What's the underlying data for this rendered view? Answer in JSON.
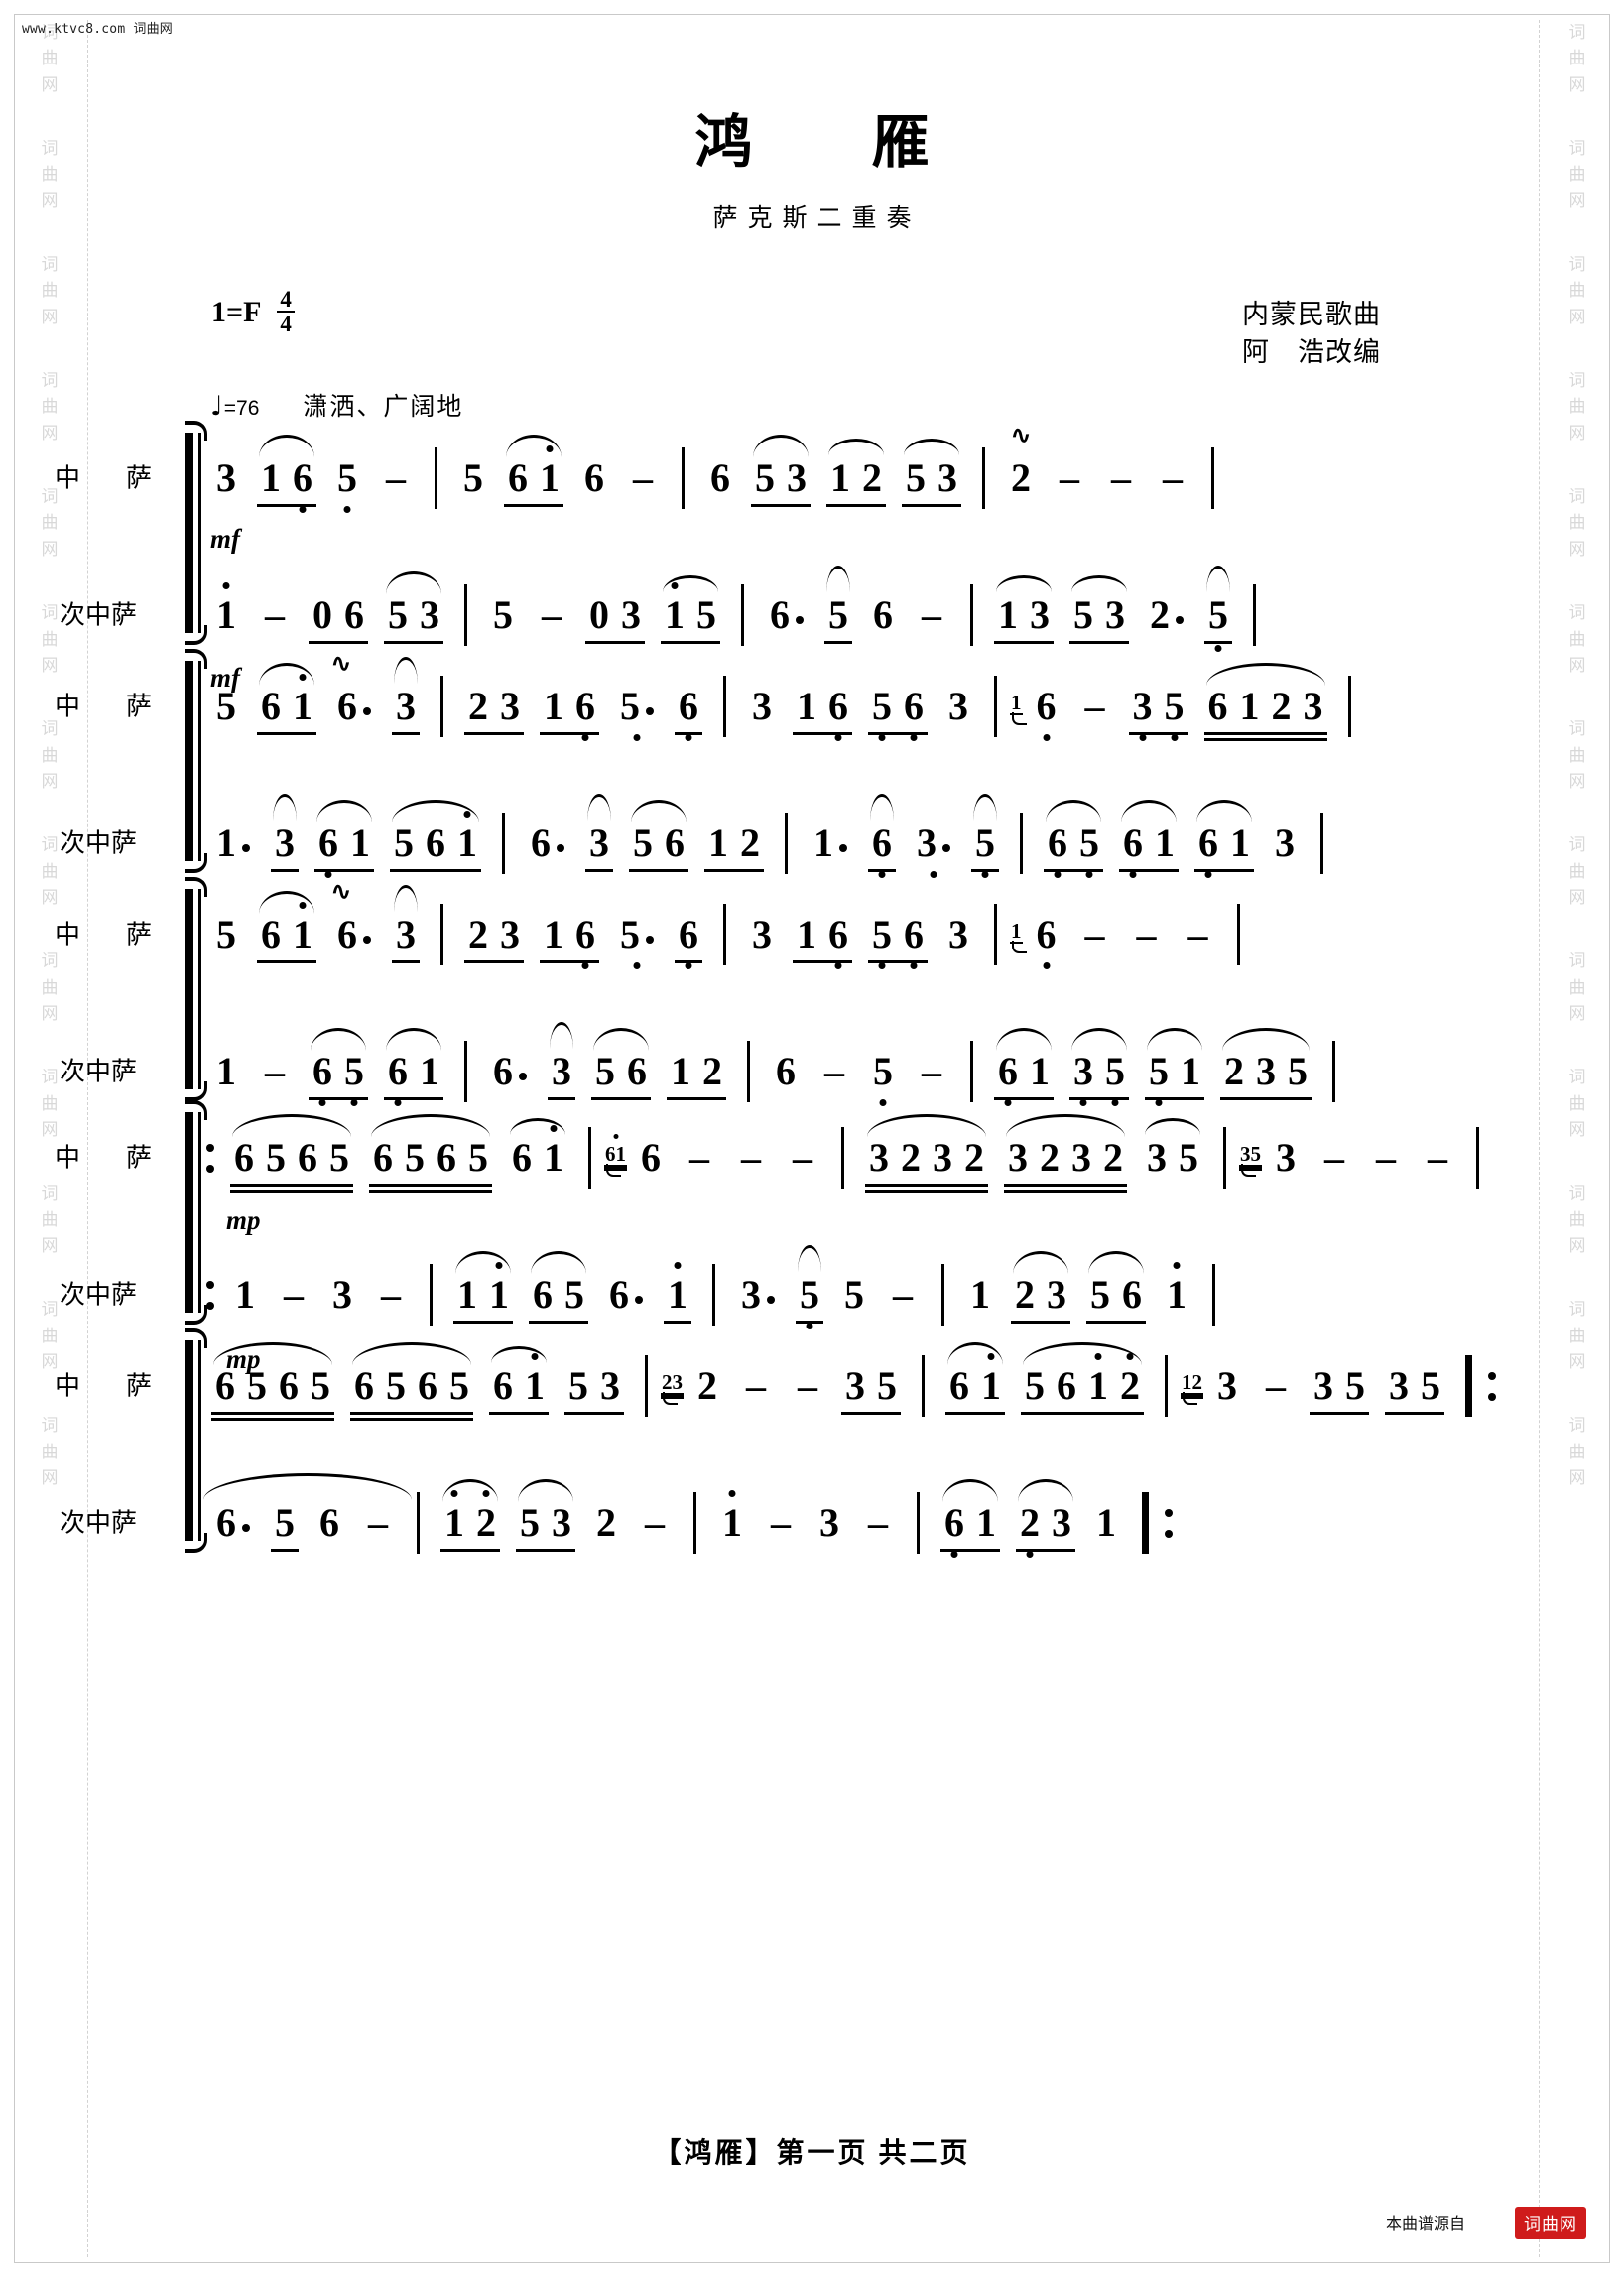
{
  "header": {
    "site_url": "www.ktvc8.com 词曲网",
    "title": "鸿雁",
    "subtitle": "萨克斯二重奏",
    "key_label": "1=F",
    "time_num": "4",
    "time_den": "4",
    "tempo_mark": "♩",
    "tempo_value": "=76",
    "expression": "潇洒、广阔地",
    "composer_line1": "内蒙民歌曲",
    "composer_line2": "阿　浩改编"
  },
  "watermark": {
    "text": "词曲网"
  },
  "parts": {
    "alto": "中　萨",
    "tenor": "次中萨"
  },
  "dynamics": {
    "mf": "mf",
    "mp": "mp"
  },
  "footer": {
    "page_note": "【鸿雁】第一页  共二页",
    "source_note": "本曲谱源自",
    "logo": "词曲网"
  },
  "chart_data": {
    "type": "table",
    "title": "鸿雁 — 萨克斯二重奏 (jianpu notation)",
    "key": "1=F",
    "meter": "4/4",
    "tempo_bpm": 76,
    "systems": [
      {
        "index": 1,
        "alto": [
          {
            "measure": 1,
            "notes": [
              "3",
              "1 6",
              "5̣",
              "-"
            ]
          },
          {
            "measure": 2,
            "notes": [
              "5",
              "6 1̇",
              "6",
              "-"
            ]
          },
          {
            "measure": 3,
            "notes": [
              "6",
              "5 3",
              "1 2",
              "5 3"
            ]
          },
          {
            "measure": 4,
            "notes": [
              "2 (trill)",
              "-",
              "-",
              "-"
            ]
          }
        ],
        "tenor": [
          {
            "measure": 1,
            "notes": [
              "1̇",
              "-",
              "0 6",
              "5 3"
            ]
          },
          {
            "measure": 2,
            "notes": [
              "5",
              "-",
              "0 3",
              "1̇ 5"
            ]
          },
          {
            "measure": 3,
            "notes": [
              "6.",
              "5",
              "6",
              "-"
            ]
          },
          {
            "measure": 4,
            "notes": [
              "1 3",
              "5 3",
              "2.",
              "5̣"
            ]
          }
        ]
      },
      {
        "index": 2,
        "alto": [
          {
            "measure": 5,
            "notes": [
              "5",
              "6 1̇",
              "6.",
              "3"
            ]
          },
          {
            "measure": 6,
            "notes": [
              "2 3",
              "1 6̣",
              "5̣.",
              "6̣"
            ]
          },
          {
            "measure": 7,
            "notes": [
              "3",
              "1 6̣",
              "5̣ 6̣",
              "3"
            ]
          },
          {
            "measure": 8,
            "notes": [
              "(1)6̣",
              "-",
              "3̣ 5̣",
              "6 1 2 3"
            ]
          }
        ],
        "tenor": [
          {
            "measure": 5,
            "notes": [
              "1.",
              "3",
              "6̣ 1",
              "5 6 1̇"
            ]
          },
          {
            "measure": 6,
            "notes": [
              "6.",
              "3",
              "5 6 1 2"
            ]
          },
          {
            "measure": 7,
            "notes": [
              "1.",
              "6̣",
              "3̣.",
              "5̣"
            ]
          },
          {
            "measure": 8,
            "notes": [
              "6̣ 5̣",
              "6̣ 1",
              "6̣ 1",
              "3"
            ]
          }
        ]
      },
      {
        "index": 3,
        "alto": [
          {
            "measure": 9,
            "notes": [
              "5",
              "6 1̇",
              "6.",
              "3"
            ]
          },
          {
            "measure": 10,
            "notes": [
              "2 3",
              "1 6̣",
              "5̣.",
              "6̣"
            ]
          },
          {
            "measure": 11,
            "notes": [
              "3",
              "1 6̣",
              "5̣ 6̣",
              "3"
            ]
          },
          {
            "measure": 12,
            "notes": [
              "(1)6̣",
              "-",
              "-",
              "-"
            ]
          }
        ],
        "tenor": [
          {
            "measure": 9,
            "notes": [
              "1",
              "-",
              "6̣ 5̣",
              "6̣ 1"
            ]
          },
          {
            "measure": 10,
            "notes": [
              "6.",
              "3",
              "5 6 1 2"
            ]
          },
          {
            "measure": 11,
            "notes": [
              "6",
              "-",
              "5̣",
              "-"
            ]
          },
          {
            "measure": 12,
            "notes": [
              "6̣ 1",
              "3̣ 5̣",
              "5̣ 1",
              "2 3 5"
            ]
          }
        ]
      },
      {
        "index": 4,
        "repeat_start": true,
        "alto": [
          {
            "measure": 13,
            "notes": [
              "6 5 6 5",
              "6 5 6 5",
              "6 1̇"
            ]
          },
          {
            "measure": 14,
            "notes": [
              "(6 1̇)6",
              "-",
              "-",
              "-"
            ]
          },
          {
            "measure": 15,
            "notes": [
              "3 2 3 2",
              "3 2 3 2",
              "3 5"
            ]
          },
          {
            "measure": 16,
            "notes": [
              "(3 5)3",
              "-",
              "-",
              "-"
            ]
          }
        ],
        "tenor": [
          {
            "measure": 13,
            "notes": [
              "1",
              "-",
              "3",
              "-"
            ]
          },
          {
            "measure": 14,
            "notes": [
              "1 1̇",
              "6 5",
              "6.",
              "1̇"
            ]
          },
          {
            "measure": 15,
            "notes": [
              "3.",
              "5̣",
              "5",
              "-"
            ]
          },
          {
            "measure": 16,
            "notes": [
              "1",
              "2 3",
              "5 6",
              "1̇"
            ]
          }
        ]
      },
      {
        "index": 5,
        "repeat_end": true,
        "alto": [
          {
            "measure": 17,
            "notes": [
              "6 5 6 5",
              "6 5 6 5",
              "6 1̇",
              "5 3"
            ]
          },
          {
            "measure": 18,
            "notes": [
              "(2 3)2",
              "-",
              "-",
              "3 5"
            ]
          },
          {
            "measure": 19,
            "notes": [
              "6 1̇",
              "5 6 1̇ 2̇"
            ]
          },
          {
            "measure": 20,
            "notes": [
              "(1 2)3",
              "-",
              "3 5",
              "3 5"
            ]
          }
        ],
        "tenor": [
          {
            "measure": 17,
            "notes": [
              "6.",
              "5",
              "6",
              "-"
            ]
          },
          {
            "measure": 18,
            "notes": [
              "1̇ 2̇",
              "5 3",
              "2",
              "-"
            ]
          },
          {
            "measure": 19,
            "notes": [
              "1̇",
              "-",
              "3",
              "-"
            ]
          },
          {
            "measure": 20,
            "notes": [
              "6̣ 1",
              "2̣ 3",
              "1",
              ":"
            ]
          }
        ]
      }
    ]
  }
}
